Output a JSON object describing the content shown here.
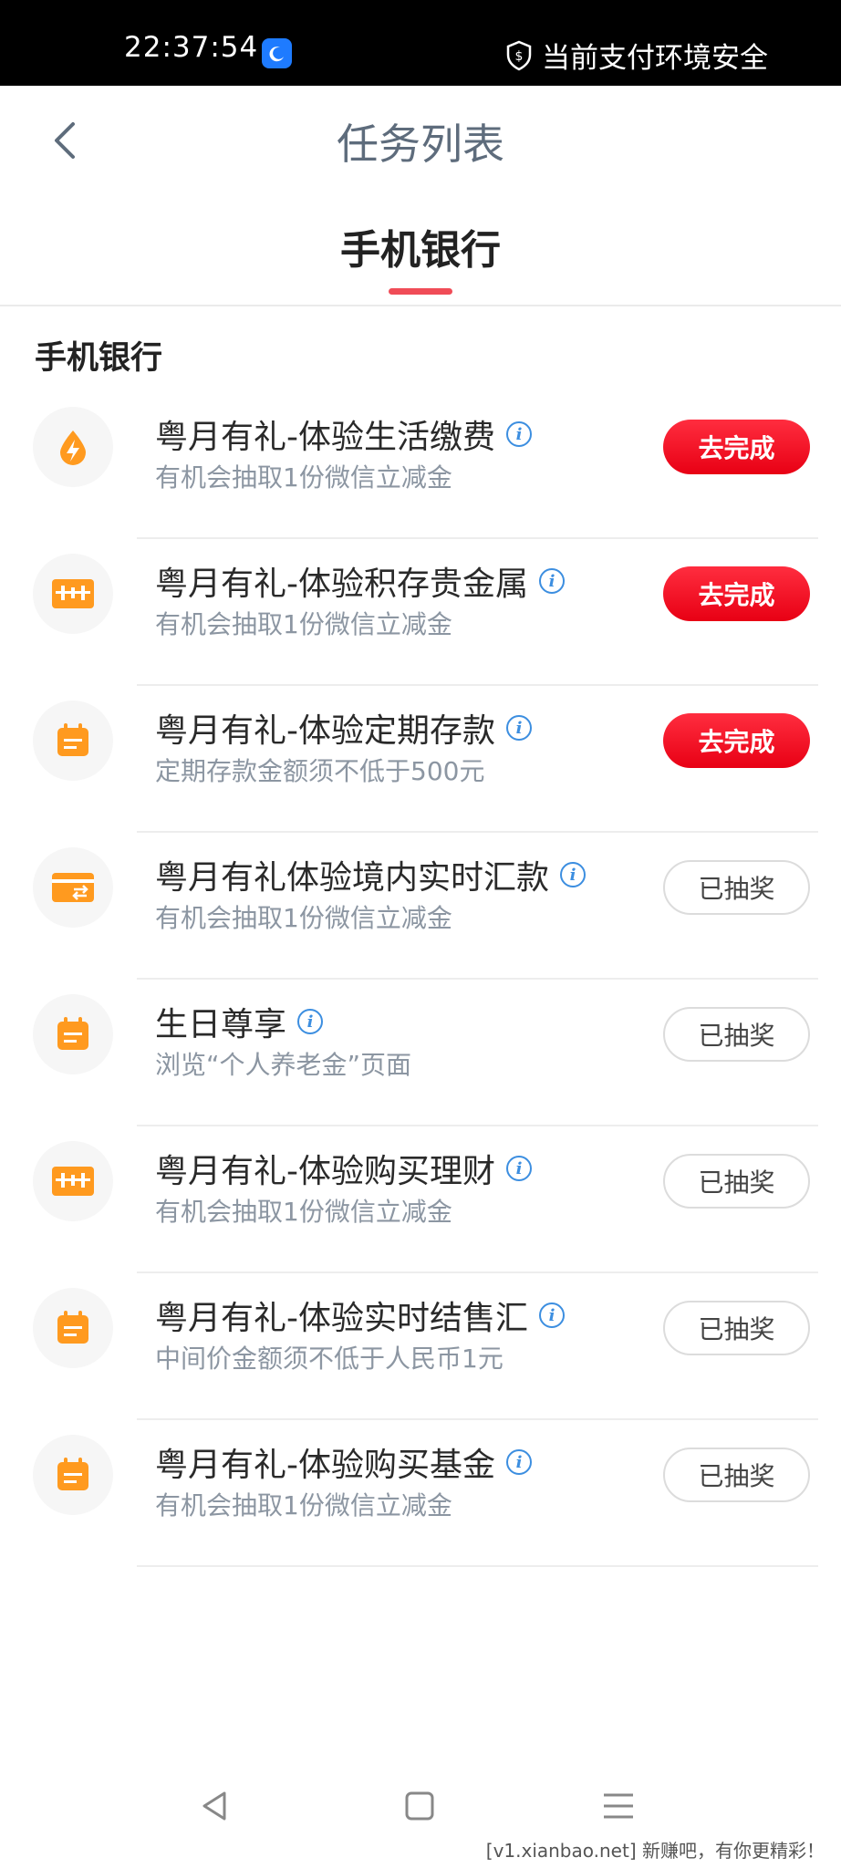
{
  "status_bar": {
    "time": "22:37:54",
    "security_text": "当前支付环境安全"
  },
  "nav": {
    "title": "任务列表",
    "back_icon": "chevron-left-icon"
  },
  "tabs": [
    {
      "label": "手机银行",
      "active": true
    }
  ],
  "section": {
    "title": "手机银行"
  },
  "tasks": [
    {
      "title": "粤月有礼-体验生活缴费",
      "subtitle": "有机会抽取1份微信立减金",
      "button": "去完成",
      "state": "active",
      "icon": "lightning-drop-icon"
    },
    {
      "title": "粤月有礼-体验积存贵金属",
      "subtitle": "有机会抽取1份微信立减金",
      "button": "去完成",
      "state": "active",
      "icon": "gold-bar-icon"
    },
    {
      "title": "粤月有礼-体验定期存款",
      "subtitle": "定期存款金额须不低于500元",
      "button": "去完成",
      "state": "active",
      "icon": "calendar-icon"
    },
    {
      "title": "粤月有礼体验境内实时汇款",
      "subtitle": "有机会抽取1份微信立减金",
      "button": "已抽奖",
      "state": "done",
      "icon": "transfer-card-icon"
    },
    {
      "title": "生日尊享",
      "subtitle": "浏览“个人养老金”页面",
      "button": "已抽奖",
      "state": "done",
      "icon": "calendar-icon"
    },
    {
      "title": "粤月有礼-体验购买理财",
      "subtitle": "有机会抽取1份微信立减金",
      "button": "已抽奖",
      "state": "done",
      "icon": "gold-bar-icon"
    },
    {
      "title": "粤月有礼-体验实时结售汇",
      "subtitle": "中间价金额须不低于人民币1元",
      "button": "已抽奖",
      "state": "done",
      "icon": "calendar-icon"
    },
    {
      "title": "粤月有礼-体验购买基金",
      "subtitle": "有机会抽取1份微信立减金",
      "button": "已抽奖",
      "state": "done",
      "icon": "calendar-icon"
    }
  ],
  "watermark": "[v1.xianbao.net] 新赚吧，有你更精彩！",
  "colors": {
    "accent_red": "#e80014",
    "icon_orange": "#ff9a1f",
    "info_blue": "#3c8ee0",
    "tab_underline": "#f04c57"
  }
}
